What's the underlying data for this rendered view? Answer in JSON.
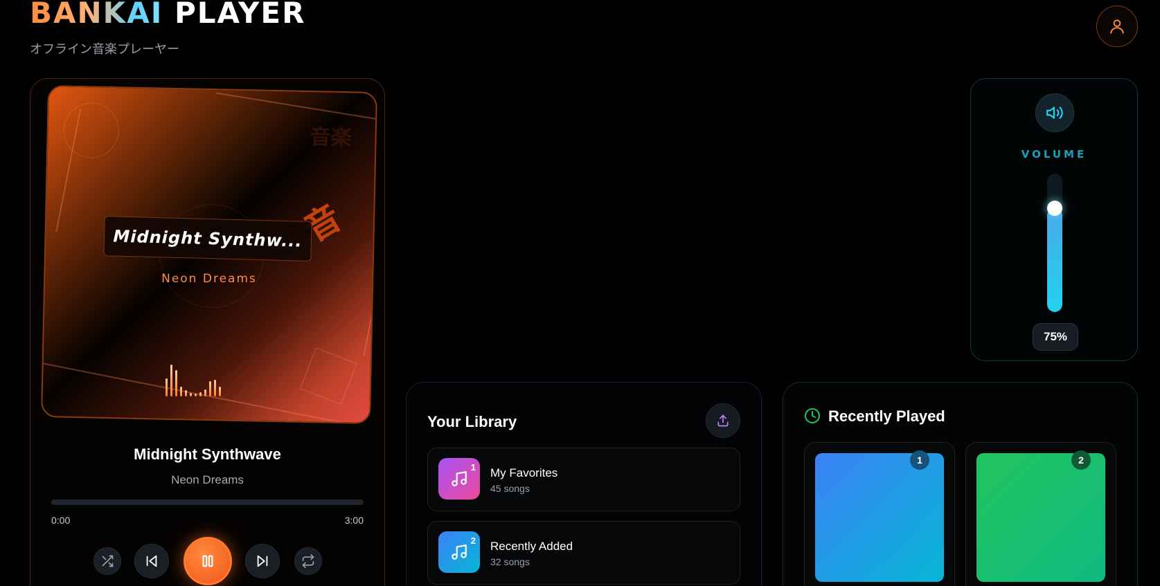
{
  "header": {
    "brand_part1": "BANKAI",
    "brand_part2": "PLAYER",
    "subtitle": "オフライン音楽プレーヤー",
    "profile_icon": "user-icon"
  },
  "player": {
    "album_title": "Midnight Synthw...",
    "album_artist": "Neon Dreams",
    "album_art_glyphs": [
      "音楽",
      "音",
      "♪"
    ],
    "track_title": "Midnight Synthwave",
    "track_artist": "Neon Dreams",
    "progress_fraction": 0,
    "time_current": "0:00",
    "time_total": "3:00",
    "is_playing": true,
    "controls": [
      "shuffle-icon",
      "previous-icon",
      "pause-icon",
      "next-icon",
      "repeat-icon"
    ],
    "eq_levels": [
      0.55,
      0.95,
      0.8,
      0.3,
      0.18,
      0.1,
      0.08,
      0.12,
      0.2,
      0.45,
      0.5,
      0.3
    ]
  },
  "volume": {
    "label": "VOLUME",
    "level_percent": 75,
    "display": "75%",
    "icon": "speaker-icon"
  },
  "library": {
    "title": "Your Library",
    "upload_icon": "upload-icon",
    "playlists": [
      {
        "name": "My Favorites",
        "count": "45 songs",
        "index": "1",
        "color_from": "#a855f7",
        "color_to": "#ec4899"
      },
      {
        "name": "Recently Added",
        "count": "32 songs",
        "index": "2",
        "color_from": "#3b82f6",
        "color_to": "#06b6d4"
      }
    ]
  },
  "recent": {
    "title": "Recently Played",
    "icon": "clock-icon",
    "items": [
      {
        "rank": "1",
        "color_from": "#3b82f6",
        "color_to": "#06b6d4"
      },
      {
        "rank": "2",
        "color_from": "#22c55e",
        "color_to": "#10b981"
      }
    ]
  },
  "colors": {
    "accent_orange": "#ff6b1a",
    "accent_cyan": "#22d3ee",
    "accent_green": "#22c55e",
    "background": "#000000"
  }
}
